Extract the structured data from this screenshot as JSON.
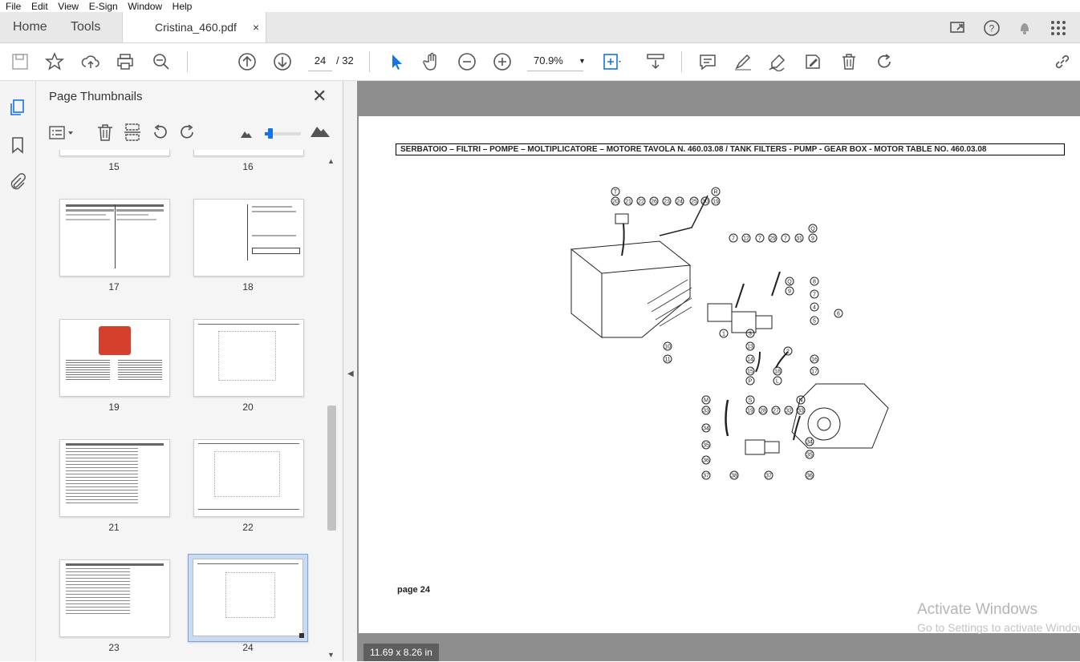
{
  "menu": [
    "File",
    "Edit",
    "View",
    "E-Sign",
    "Window",
    "Help"
  ],
  "tabs": {
    "home": "Home",
    "tools": "Tools",
    "document": "Cristina_460.pdf",
    "close_glyph": "×"
  },
  "toolbar": {
    "current_page": "24",
    "total_pages": "/ 32",
    "zoom": "70.9%"
  },
  "icons": {
    "save": "save-icon",
    "star": "star-icon",
    "upload": "cloud-upload-icon",
    "print": "printer-icon",
    "zoom_search": "zoom-search-icon",
    "prev": "arrow-up-circle-icon",
    "next": "arrow-down-circle-icon",
    "select": "pointer-icon",
    "hand": "hand-icon",
    "zoom_out": "zoom-out-icon",
    "zoom_in": "zoom-in-icon",
    "fit": "fit-page-icon",
    "scroll": "scroll-mode-icon",
    "comment": "comment-icon",
    "highlight": "highlight-pen-icon",
    "sign": "sign-icon",
    "fill": "fill-sign-icon",
    "delete": "trash-icon",
    "rotate": "rotate-icon",
    "share": "link-share-icon"
  },
  "sidebar": {
    "title": "Page Thumbnails",
    "close_glyph": "✕",
    "thumbnails": [
      {
        "label": "15"
      },
      {
        "label": "16"
      },
      {
        "label": "17"
      },
      {
        "label": "18"
      },
      {
        "label": "19"
      },
      {
        "label": "20"
      },
      {
        "label": "21"
      },
      {
        "label": "22"
      },
      {
        "label": "23"
      },
      {
        "label": "24",
        "selected": true
      }
    ]
  },
  "document": {
    "heading": "SERBATOIO – FILTRI – POMPE – MOLTIPLICATORE – MOTORE   TAVOLA N. 460.03.08 /  TANK FILTERS - PUMP - GEAR BOX - MOTOR TABLE NO. 460.03.08",
    "footer": "page 24",
    "page_size": "11.69 x 8.26 in",
    "callouts_top": [
      "T",
      "20",
      "21",
      "22",
      "26",
      "23",
      "24",
      "25",
      "30",
      "R",
      "19"
    ],
    "callouts_mid": [
      "7",
      "12",
      "7",
      "29",
      "7",
      "31",
      "Q",
      "9",
      "Q",
      "9",
      "8",
      "7",
      "4",
      "6",
      "5",
      "1",
      "3",
      "13",
      "2",
      "14",
      "16",
      "15",
      "18",
      "17",
      "P",
      "L",
      "10",
      "11"
    ],
    "callouts_bottom": [
      "M",
      "S",
      "N",
      "33",
      "19",
      "28",
      "27",
      "32",
      "33",
      "34",
      "35",
      "36",
      "37",
      "38",
      "37",
      "36",
      "34",
      "35"
    ]
  },
  "watermark": {
    "line1": "Activate Windows",
    "line2": "Go to Settings to activate Windows."
  },
  "colors": {
    "accent": "#1473e6",
    "doc_background": "#8e8e8e",
    "selected_thumb": "#c9dbf2"
  }
}
